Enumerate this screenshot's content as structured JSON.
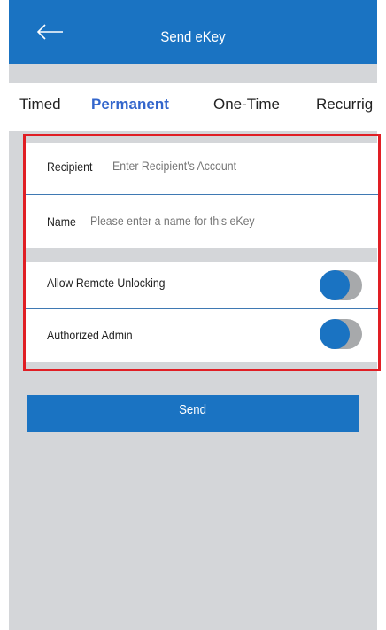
{
  "header": {
    "title": "Send eKey",
    "back_icon": "arrow-left-icon"
  },
  "tabs": [
    {
      "label": "Timed",
      "active": false
    },
    {
      "label": "Permanent",
      "active": true
    },
    {
      "label": "One-Time",
      "active": false
    },
    {
      "label": "Recurrig",
      "active": false
    }
  ],
  "form": {
    "recipient": {
      "label": "Recipient",
      "placeholder": "Enter Recipient's Account",
      "value": ""
    },
    "name": {
      "label": "Name",
      "placeholder": "Please enter a name for this eKey",
      "value": ""
    },
    "allow_remote_unlocking": {
      "label": "Allow Remote Unlocking"
    },
    "authorized_admin": {
      "label": "Authorized Admin"
    }
  },
  "send_button": {
    "label": "Send"
  },
  "colors": {
    "primary": "#1a73c2",
    "highlight_border": "#e01e24",
    "active_tab": "#3366cc",
    "background": "#d4d6d9"
  }
}
